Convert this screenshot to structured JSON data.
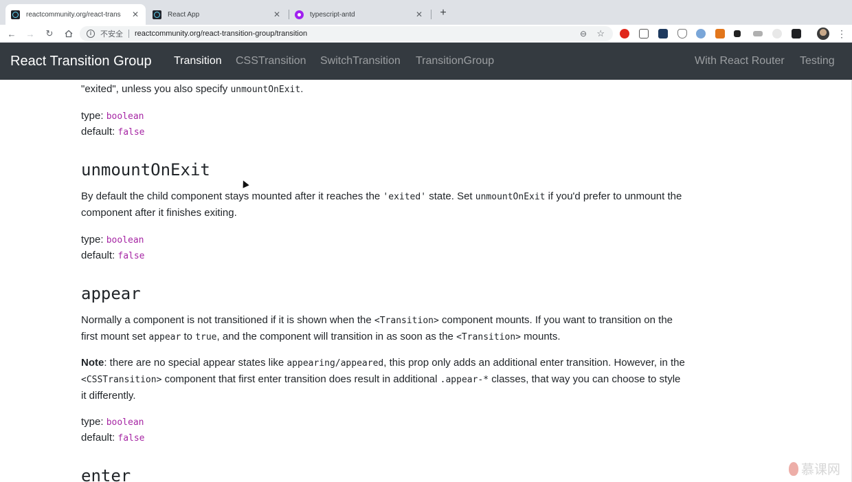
{
  "browser": {
    "tabs": [
      {
        "label": "reactcommunity.org/react-trans",
        "favicon": "react-icon"
      },
      {
        "label": "React App",
        "favicon": "react-icon"
      },
      {
        "label": "typescript-antd",
        "favicon": "purple-circle-icon"
      }
    ],
    "new_tab": "+",
    "security_label": "不安全",
    "url": "reactcommunity.org/react-transition-group/transition"
  },
  "navbar": {
    "brand": "React Transition Group",
    "links": [
      "Transition",
      "CSSTransition",
      "SwitchTransition",
      "TransitionGroup"
    ],
    "right_links": [
      "With React Router",
      "Testing"
    ],
    "active": "Transition"
  },
  "content": {
    "top": {
      "text_before": "\"exited\", unless you also specify ",
      "code": "unmountOnExit",
      "text_after": ".",
      "type_label": "type: ",
      "type_value": "boolean",
      "default_label": "default: ",
      "default_value": "false"
    },
    "unmount": {
      "heading": "unmountOnExit",
      "p1": "By default the child component stays mounted after it reaches the ",
      "c1": "'exited'",
      "p2": " state. Set ",
      "c2": "unmountOnExit",
      "p3": " if you'd prefer to unmount the",
      "p4": "component after it finishes exiting.",
      "type_label": "type: ",
      "type_value": "boolean",
      "default_label": "default: ",
      "default_value": "false"
    },
    "appear": {
      "heading": "appear",
      "p1": "Normally a component is not transitioned if it is shown when the ",
      "c1": "<Transition>",
      "p2": " component mounts. If you want to transition on the",
      "p3": "first mount set ",
      "c2": "appear",
      "p4": " to ",
      "c3": "true",
      "p5": ", and the component will transition in as soon as the ",
      "c4": "<Transition>",
      "p6": " mounts.",
      "note_bold": "Note",
      "n1": ": there are no special appear states like ",
      "nc1": "appearing/appeared",
      "n2": ", this prop only adds an additional enter transition. However, in the",
      "nc2": "<CSSTransition>",
      "n3": " component that first enter transition does result in additional ",
      "nc3": ".appear-*",
      "n4": " classes, that way you can choose to style",
      "n5": "it differently.",
      "type_label": "type: ",
      "type_value": "boolean",
      "default_label": "default: ",
      "default_value": "false"
    },
    "next_heading": "enter"
  },
  "watermark": "慕课网",
  "colors": {
    "navbar_bg": "#343a40",
    "keyword": "#a626a4",
    "tab_bg": "#dee1e6"
  }
}
